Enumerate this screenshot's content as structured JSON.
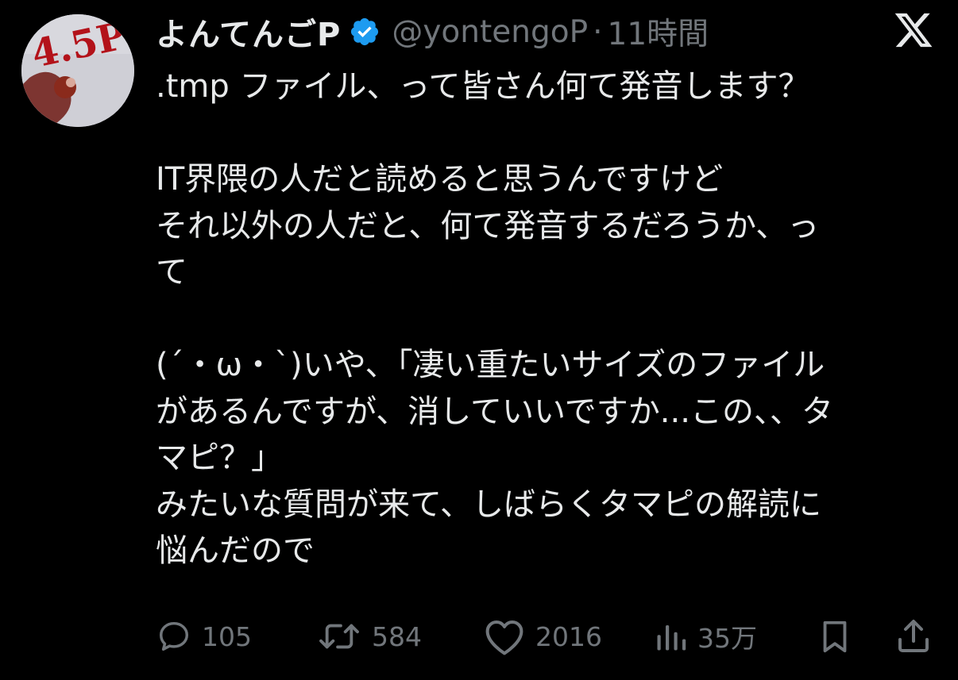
{
  "author": {
    "display_name": "よんてんごP",
    "handle": "@yontengoP",
    "separator": "·",
    "time": "11時間",
    "avatar_text": "4.5P"
  },
  "tweet": {
    "lines": [
      ".tmp ファイル、って皆さん何て発音します？",
      "",
      "IT界隈の人だと読めると思うんですけど",
      "それ以外の人だと、何て発音するだろうか、っ",
      "て",
      "",
      "(´・ω・`)いや、「凄い重たいサイズのファイル",
      "があるんですが、消していいですか...この、、タ",
      "マピ？」",
      "みたいな質問が来て、しばらくタマピの解読に",
      "悩んだので"
    ]
  },
  "actions": {
    "replies": "105",
    "reposts": "584",
    "likes": "2016",
    "views": "35万"
  },
  "icons": {
    "brand": "x-logo-icon",
    "verified": "verified-badge-icon",
    "reply": "reply-icon",
    "repost": "repost-icon",
    "like": "heart-icon",
    "views": "views-chart-icon",
    "bookmark": "bookmark-icon",
    "share": "share-icon"
  },
  "colors": {
    "background": "#000000",
    "primary_text": "#e7e9ea",
    "secondary_text": "#71767b",
    "verified_blue": "#1d9bf0"
  }
}
